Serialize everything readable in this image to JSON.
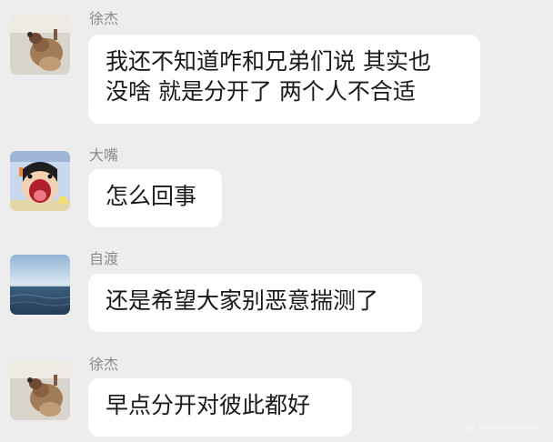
{
  "messages": [
    {
      "sender": "徐杰",
      "avatar": "dog-avatar",
      "lines": [
        "我还不知道咋和兄弟们说 其实也",
        "没啥 就是分开了 两个人不合适"
      ]
    },
    {
      "sender": "大嘴",
      "avatar": "cartoon-avatar",
      "lines": [
        "怎么回事"
      ]
    },
    {
      "sender": "自渡",
      "avatar": "seascape-avatar",
      "lines": [
        "还是希望大家别恶意揣测了"
      ]
    },
    {
      "sender": "徐杰",
      "avatar": "dog-avatar",
      "lines": [
        "早点分开对彼此都好"
      ]
    }
  ],
  "colors": {
    "background": "#ededed",
    "bubble": "#ffffff",
    "sender_name": "#8b8b8b",
    "message_text": "#191919"
  }
}
